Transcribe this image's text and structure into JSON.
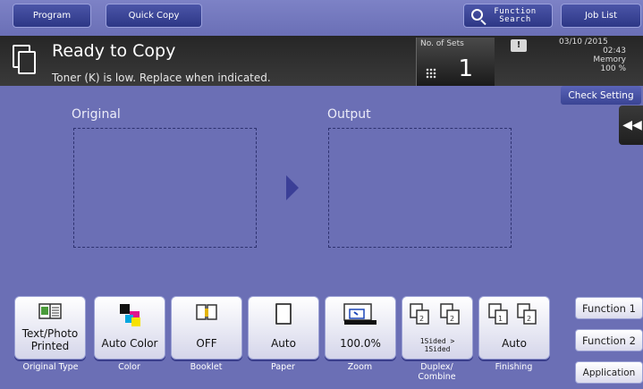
{
  "topbar": {
    "program_label": "Program",
    "quickcopy_label": "Quick Copy",
    "search_label_line1": "Function",
    "search_label_line2": "Search",
    "joblist_label": "Job List"
  },
  "status": {
    "title": "Ready to Copy",
    "message": "Toner (K) is low. Replace when indicated.",
    "sets_label": "No. of Sets",
    "sets_value": "1",
    "warning_glyph": "!",
    "date": "03/10 /2015",
    "time": "02:43",
    "memory_label": "Memory",
    "memory_value": "100 %",
    "check_setting_label": "Check Setting"
  },
  "preview": {
    "original_label": "Original",
    "output_label": "Output"
  },
  "functions": [
    {
      "value": "Text/Photo\nPrinted",
      "label": "Original Type",
      "icon": "text-photo-icon"
    },
    {
      "value": "Auto Color",
      "label": "Color",
      "icon": "color-icon"
    },
    {
      "value": "OFF",
      "label": "Booklet",
      "icon": "booklet-icon"
    },
    {
      "value": "Auto",
      "label": "Paper",
      "icon": "paper-icon"
    },
    {
      "value": "100.0%",
      "label": "Zoom",
      "icon": "zoom-icon"
    },
    {
      "value": "1Sided >\n1Sided",
      "label": "Duplex/\nCombine",
      "icon": "duplex-icon"
    },
    {
      "value": "Auto",
      "label": "Finishing",
      "icon": "finishing-icon"
    }
  ],
  "side": {
    "function1_label": "Function 1",
    "function2_label": "Function 2",
    "application_label": "Application"
  },
  "colors": {
    "panel_bg": "#6b6fb5",
    "header_dark": "#2c2c2c",
    "button_face": "#ffffff"
  }
}
